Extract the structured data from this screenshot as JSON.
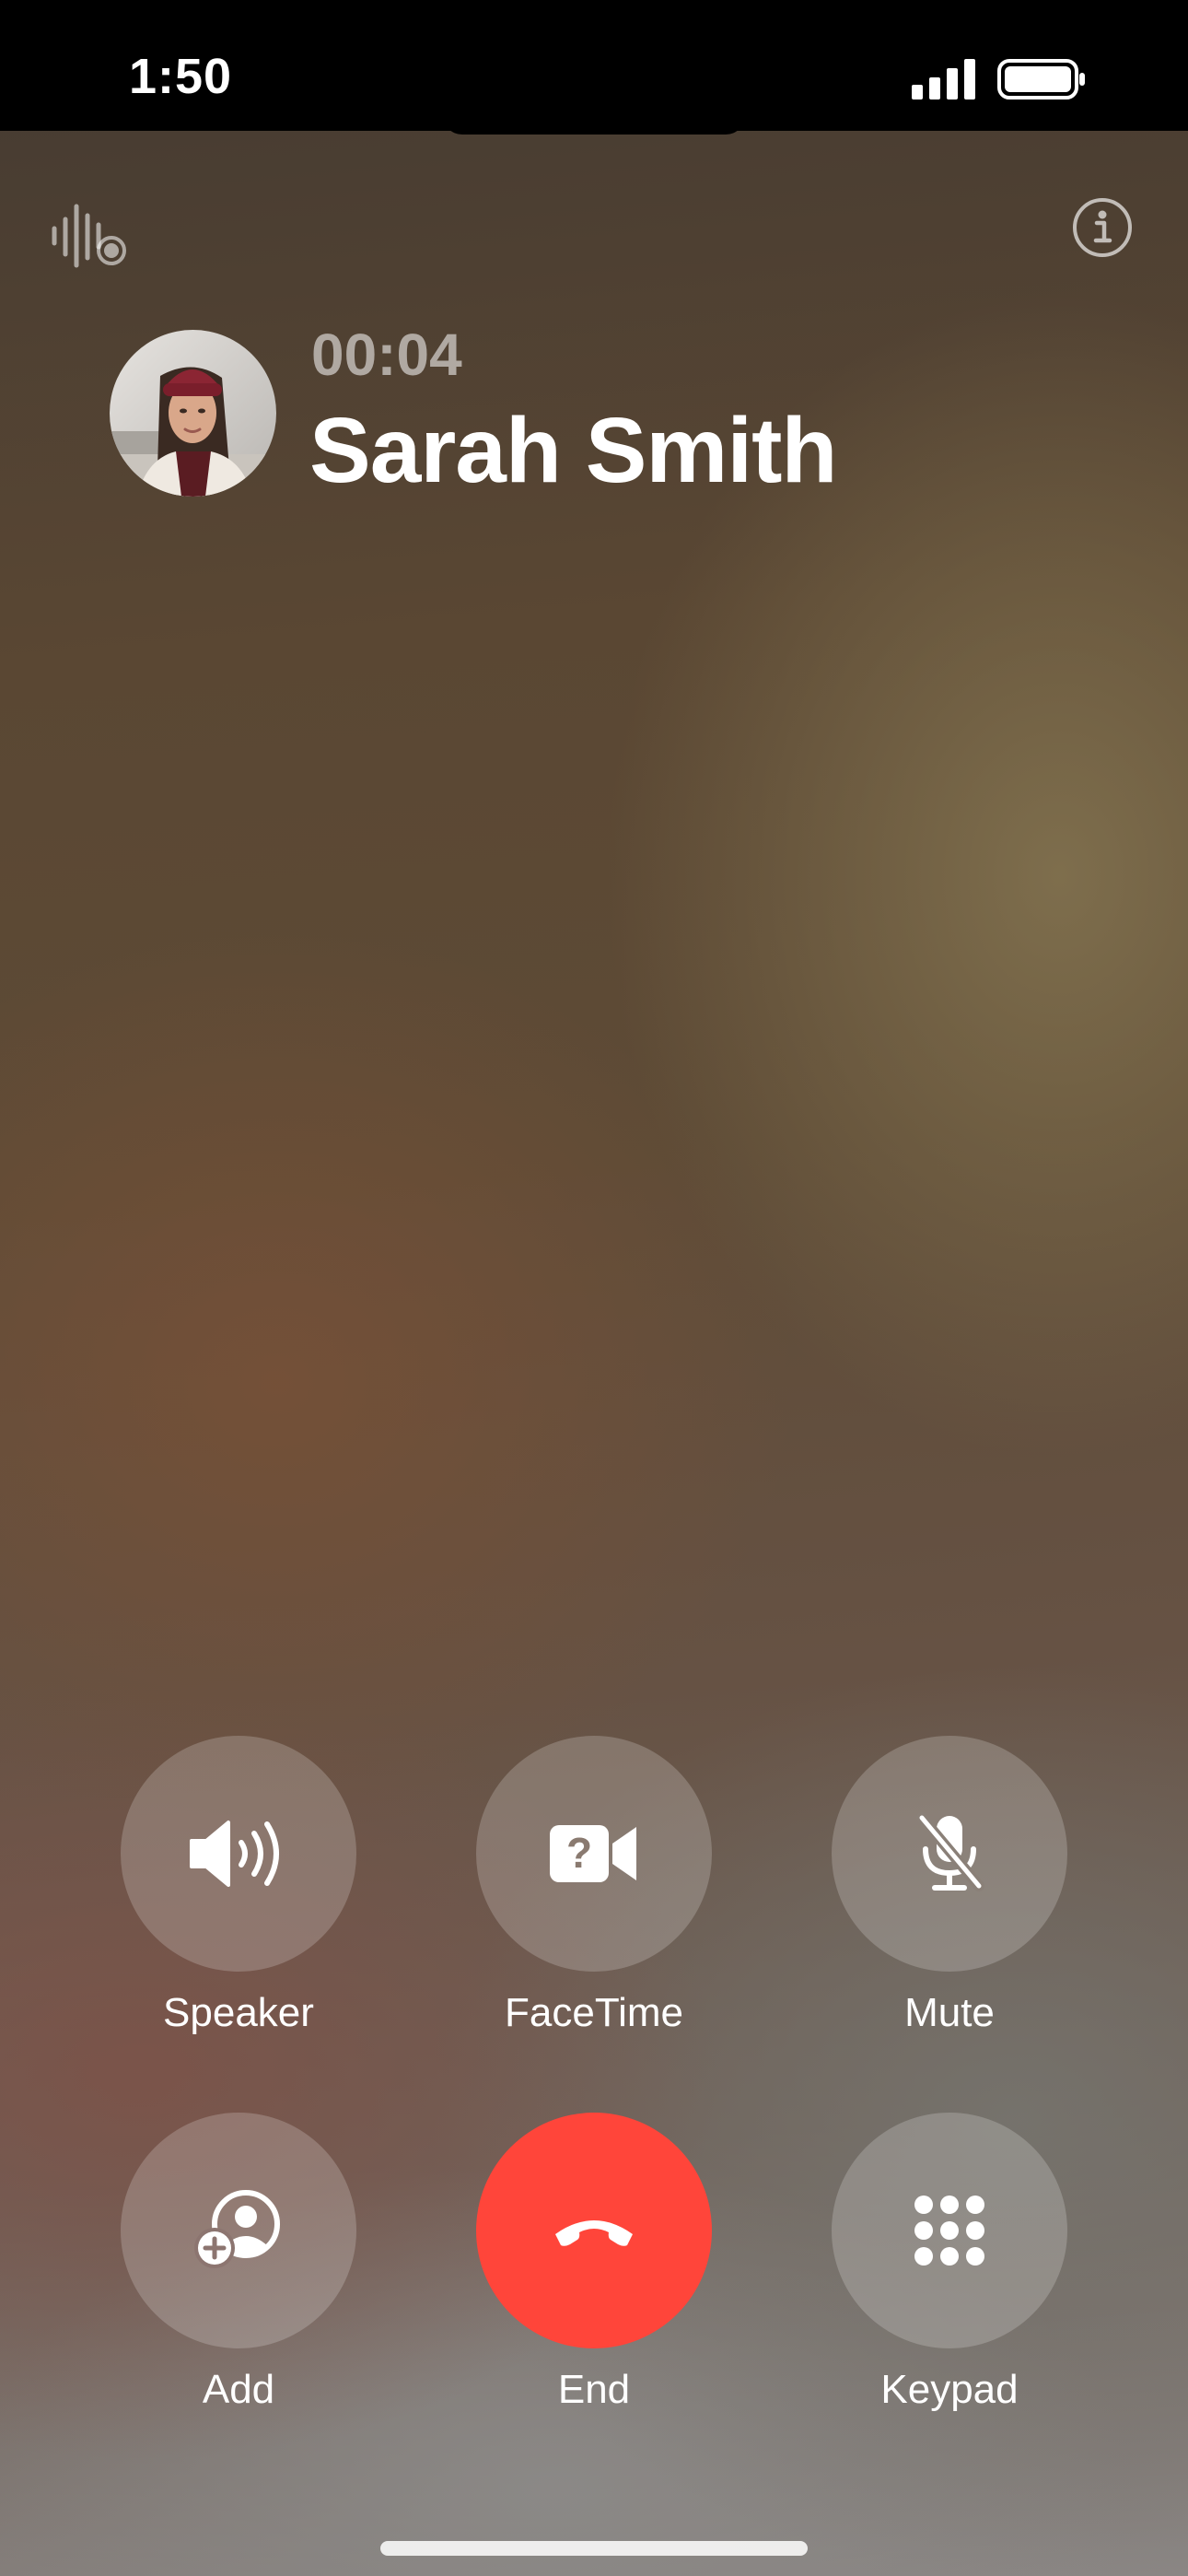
{
  "status_bar": {
    "time": "1:50",
    "icons": [
      "signal-icon",
      "battery-icon"
    ]
  },
  "call": {
    "timer": "00:04",
    "caller_name": "Sarah Smith",
    "top_icons": [
      "live-voicemail-recording-icon",
      "info-icon"
    ]
  },
  "controls": {
    "speaker_label": "Speaker",
    "facetime_label": "FaceTime",
    "mute_label": "Mute",
    "add_label": "Add",
    "end_label": "End",
    "keypad_label": "Keypad"
  },
  "colors": {
    "end_button": "#ff453a",
    "control_button": "rgba(255,255,255,0.2)",
    "timer_text": "rgba(255,255,255,0.55)"
  }
}
